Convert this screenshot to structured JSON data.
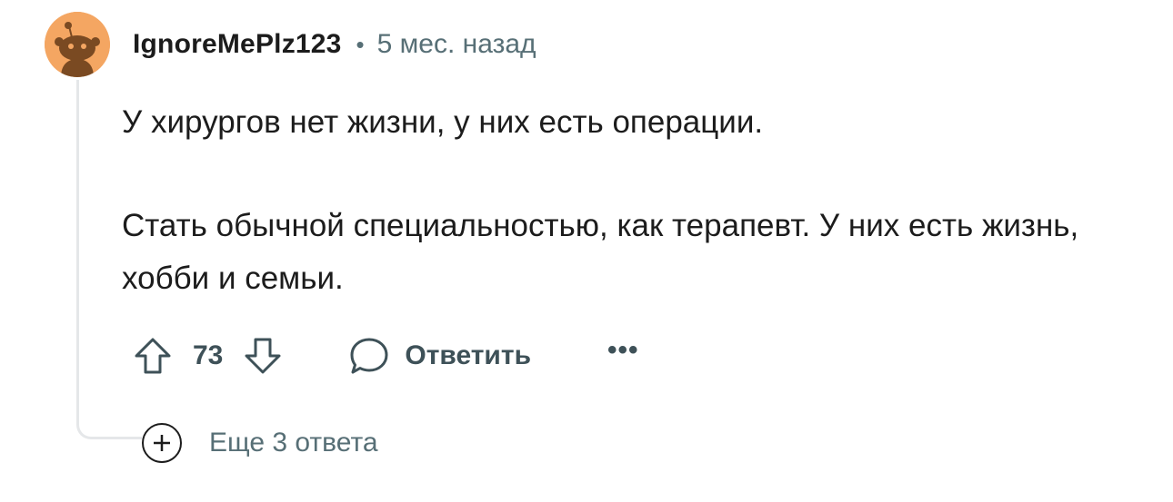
{
  "comment": {
    "username": "IgnoreMePlz123",
    "separator": "•",
    "time_ago": "5 мес. назад",
    "avatar_icon": "snoo-avatar-icon",
    "avatar_color": "#f4a662",
    "paragraphs": [
      "У хирургов нет жизни, у них есть операции.",
      "Стать обычной специальностью, как терапевт. У них есть жизнь, хобби и семьи."
    ],
    "actions": {
      "upvote_icon": "upvote-arrow-icon",
      "vote_count": "73",
      "downvote_icon": "downvote-arrow-icon",
      "reply_icon": "speech-bubble-icon",
      "reply_label": "Ответить",
      "more_label": "•••"
    },
    "more_replies": {
      "icon": "plus-circle-icon",
      "label": "Еще 3 ответа"
    }
  },
  "colors": {
    "text_primary": "#1c1c1c",
    "text_secondary": "#576f76",
    "action_text": "#3e5158",
    "thread_line": "#e5e7e9"
  }
}
